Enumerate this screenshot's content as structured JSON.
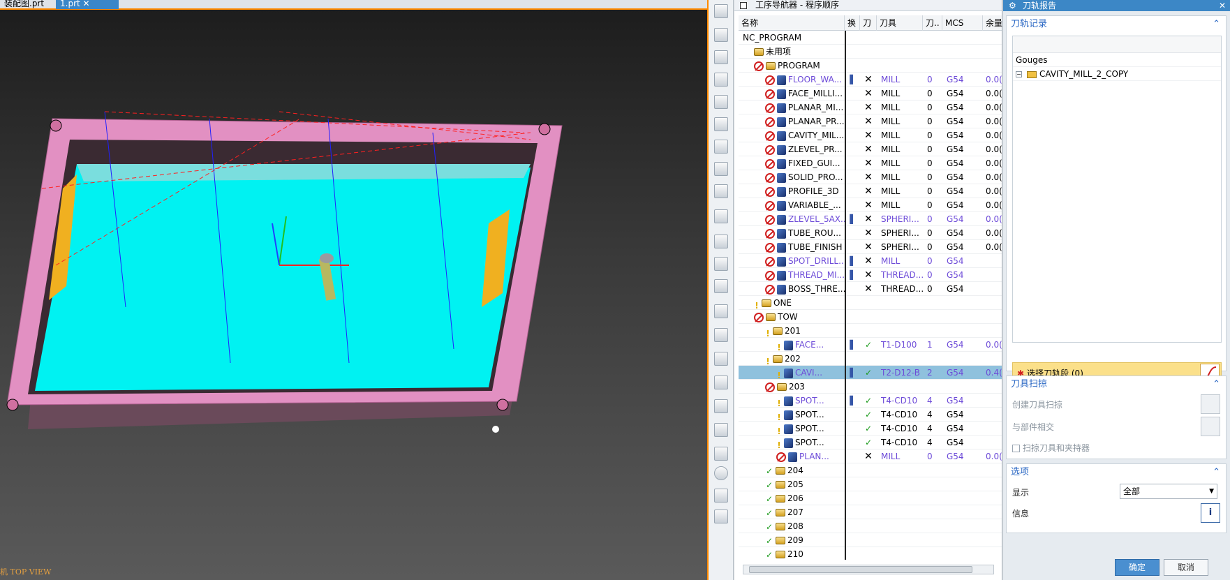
{
  "tabs": {
    "assembly": "装配图.prt",
    "part": "1.prt"
  },
  "viewport": {
    "view_label": "机 TOP VIEW"
  },
  "navigator": {
    "title": "工序导航器 - 程序顺序",
    "columns": {
      "name": "名称",
      "swap": "换",
      "t": "刀",
      "tool": "刀具",
      "tn": "刀..",
      "mcs": "MCS",
      "rem": "余量"
    },
    "rows": [
      {
        "name": "NC_PROGRAM",
        "swap": "",
        "t": "",
        "tool": "",
        "tn": "",
        "mcs": "",
        "rem": ""
      },
      {
        "name": "未用项",
        "swap": "",
        "t": "",
        "tool": "",
        "tn": "",
        "mcs": "",
        "rem": ""
      },
      {
        "name": "PROGRAM",
        "swap": "",
        "t": "",
        "tool": "",
        "tn": "",
        "mcs": "",
        "rem": ""
      },
      {
        "name": "FLOOR_WA...",
        "swap": "▌",
        "t": "✕",
        "tool": "MILL",
        "tn": "0",
        "mcs": "G54",
        "rem": "0.0("
      },
      {
        "name": "FACE_MILLI...",
        "swap": "",
        "t": "✕",
        "tool": "MILL",
        "tn": "0",
        "mcs": "G54",
        "rem": "0.0("
      },
      {
        "name": "PLANAR_MI...",
        "swap": "",
        "t": "✕",
        "tool": "MILL",
        "tn": "0",
        "mcs": "G54",
        "rem": "0.0("
      },
      {
        "name": "PLANAR_PR...",
        "swap": "",
        "t": "✕",
        "tool": "MILL",
        "tn": "0",
        "mcs": "G54",
        "rem": "0.0("
      },
      {
        "name": "CAVITY_MIL...",
        "swap": "",
        "t": "✕",
        "tool": "MILL",
        "tn": "0",
        "mcs": "G54",
        "rem": "0.0("
      },
      {
        "name": "ZLEVEL_PR...",
        "swap": "",
        "t": "✕",
        "tool": "MILL",
        "tn": "0",
        "mcs": "G54",
        "rem": "0.0("
      },
      {
        "name": "FIXED_GUI...",
        "swap": "",
        "t": "✕",
        "tool": "MILL",
        "tn": "0",
        "mcs": "G54",
        "rem": "0.0("
      },
      {
        "name": "SOLID_PRO...",
        "swap": "",
        "t": "✕",
        "tool": "MILL",
        "tn": "0",
        "mcs": "G54",
        "rem": "0.0("
      },
      {
        "name": "PROFILE_3D",
        "swap": "",
        "t": "✕",
        "tool": "MILL",
        "tn": "0",
        "mcs": "G54",
        "rem": "0.0("
      },
      {
        "name": "VARIABLE_...",
        "swap": "",
        "t": "✕",
        "tool": "MILL",
        "tn": "0",
        "mcs": "G54",
        "rem": "0.0("
      },
      {
        "name": "ZLEVEL_5AX...",
        "swap": "▌",
        "t": "✕",
        "tool": "SPHERI...",
        "tn": "0",
        "mcs": "G54",
        "rem": "0.0("
      },
      {
        "name": "TUBE_ROU...",
        "swap": "",
        "t": "✕",
        "tool": "SPHERI...",
        "tn": "0",
        "mcs": "G54",
        "rem": "0.0("
      },
      {
        "name": "TUBE_FINISH",
        "swap": "",
        "t": "✕",
        "tool": "SPHERI...",
        "tn": "0",
        "mcs": "G54",
        "rem": "0.0("
      },
      {
        "name": "SPOT_DRILL...",
        "swap": "▌",
        "t": "✕",
        "tool": "MILL",
        "tn": "0",
        "mcs": "G54",
        "rem": ""
      },
      {
        "name": "THREAD_MI...",
        "swap": "▌",
        "t": "✕",
        "tool": "THREAD...",
        "tn": "0",
        "mcs": "G54",
        "rem": ""
      },
      {
        "name": "BOSS_THRE...",
        "swap": "",
        "t": "✕",
        "tool": "THREAD...",
        "tn": "0",
        "mcs": "G54",
        "rem": ""
      },
      {
        "name": "ONE",
        "swap": "",
        "t": "",
        "tool": "",
        "tn": "",
        "mcs": "",
        "rem": ""
      },
      {
        "name": "TOW",
        "swap": "",
        "t": "",
        "tool": "",
        "tn": "",
        "mcs": "",
        "rem": ""
      },
      {
        "name": "201",
        "swap": "",
        "t": "",
        "tool": "",
        "tn": "",
        "mcs": "",
        "rem": ""
      },
      {
        "name": "FACE...",
        "swap": "▌",
        "t": "✓",
        "tool": "T1-D100",
        "tn": "1",
        "mcs": "G54",
        "rem": "0.0("
      },
      {
        "name": "202",
        "swap": "",
        "t": "",
        "tool": "",
        "tn": "",
        "mcs": "",
        "rem": ""
      },
      {
        "name": "CAVI...",
        "swap": "▌",
        "t": "✓",
        "tool": "T2-D12-B",
        "tn": "2",
        "mcs": "G54",
        "rem": "0.4("
      },
      {
        "name": "203",
        "swap": "",
        "t": "",
        "tool": "",
        "tn": "",
        "mcs": "",
        "rem": ""
      },
      {
        "name": "SPOT...",
        "swap": "▌",
        "t": "✓",
        "tool": "T4-CD10",
        "tn": "4",
        "mcs": "G54",
        "rem": ""
      },
      {
        "name": "SPOT...",
        "swap": "",
        "t": "✓",
        "tool": "T4-CD10",
        "tn": "4",
        "mcs": "G54",
        "rem": ""
      },
      {
        "name": "SPOT...",
        "swap": "",
        "t": "✓",
        "tool": "T4-CD10",
        "tn": "4",
        "mcs": "G54",
        "rem": ""
      },
      {
        "name": "SPOT...",
        "swap": "",
        "t": "✓",
        "tool": "T4-CD10",
        "tn": "4",
        "mcs": "G54",
        "rem": ""
      },
      {
        "name": "PLAN...",
        "swap": "",
        "t": "✕",
        "tool": "MILL",
        "tn": "0",
        "mcs": "G54",
        "rem": "0.0("
      },
      {
        "name": "204",
        "swap": "",
        "t": "",
        "tool": "",
        "tn": "",
        "mcs": "",
        "rem": ""
      },
      {
        "name": "205",
        "swap": "",
        "t": "",
        "tool": "",
        "tn": "",
        "mcs": "",
        "rem": ""
      },
      {
        "name": "206",
        "swap": "",
        "t": "",
        "tool": "",
        "tn": "",
        "mcs": "",
        "rem": ""
      },
      {
        "name": "207",
        "swap": "",
        "t": "",
        "tool": "",
        "tn": "",
        "mcs": "",
        "rem": ""
      },
      {
        "name": "208",
        "swap": "",
        "t": "",
        "tool": "",
        "tn": "",
        "mcs": "",
        "rem": ""
      },
      {
        "name": "209",
        "swap": "",
        "t": "",
        "tool": "",
        "tn": "",
        "mcs": "",
        "rem": ""
      },
      {
        "name": "210",
        "swap": "",
        "t": "",
        "tool": "",
        "tn": "",
        "mcs": "",
        "rem": ""
      }
    ]
  },
  "report": {
    "title": "刀轨报告",
    "section_toolpath": "刀轨记录",
    "tree_header": "Gouges",
    "tree_item": "CAVITY_MILL_2_COPY",
    "select_label": "选择刀轨段 (0)",
    "section_sweep": "刀具扫掠",
    "create_sweep": "创建刀具扫掠",
    "intersect_part": "与部件相交",
    "sweep_holder": "扫掠刀具和夹持器",
    "section_options": "选项",
    "display_label": "显示",
    "display_value": "全部",
    "info_label": "信息",
    "ok": "确定",
    "cancel": "取消"
  },
  "colors": {
    "accent": "#3c87c6",
    "orange": "#ff8a00",
    "cyan": "#00f5f5",
    "pink": "#e090c0",
    "select": "#fbe08a"
  }
}
